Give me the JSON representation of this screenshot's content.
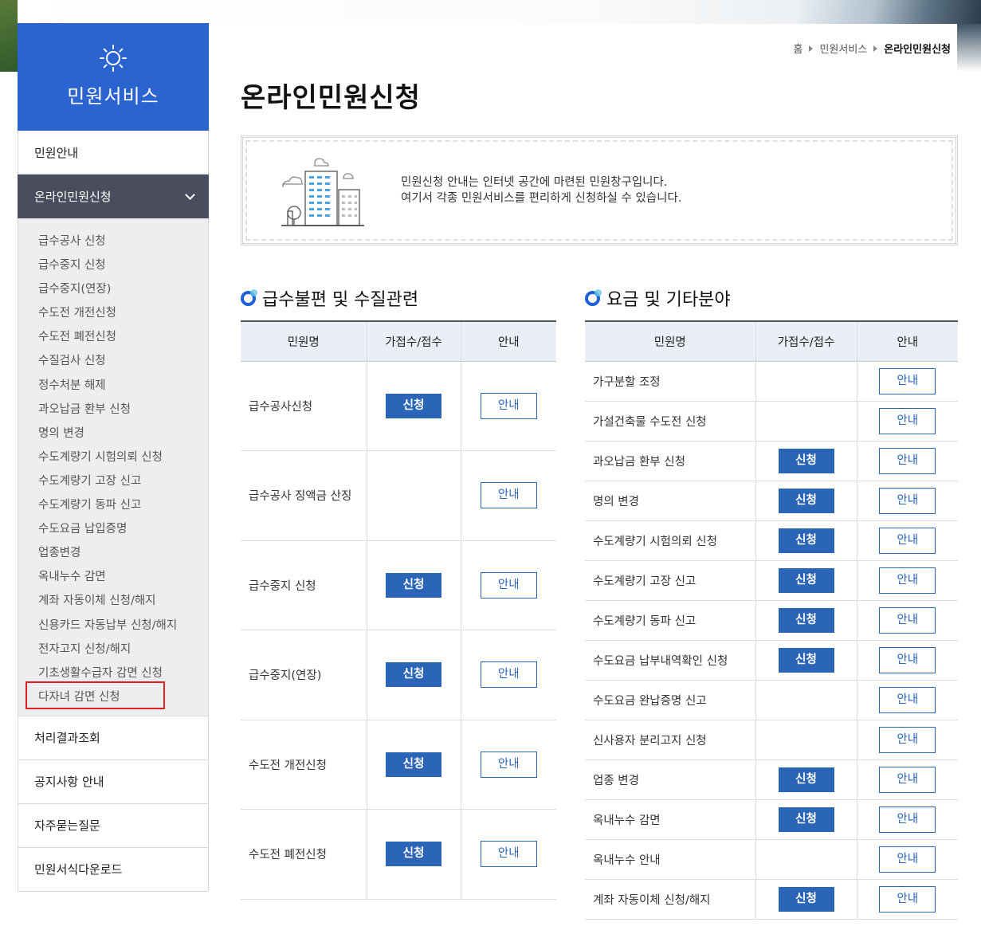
{
  "sidebar": {
    "title": "민원서비스",
    "icon": "sun-icon",
    "items": [
      {
        "label": "민원안내"
      },
      {
        "label": "온라인민원신청"
      },
      {
        "label": "처리결과조회"
      },
      {
        "label": "공지사항 안내"
      },
      {
        "label": "자주묻는질문"
      },
      {
        "label": "민원서식다운로드"
      }
    ],
    "submenu": [
      "급수공사 신청",
      "급수중지 신청",
      "급수중지(연장)",
      "수도전 개전신청",
      "수도전 폐전신청",
      "수질검사 신청",
      "정수처분 해제",
      "과오납금 환부 신청",
      "명의 변경",
      "수도계량기 시험의뢰 신청",
      "수도계량기 고장 신고",
      "수도계량기 동파 신고",
      "수도요금 납입증명",
      "업종변경",
      "옥내누수 감면",
      "계좌 자동이체 신청/해지",
      "신용카드 자동납부 신청/해지",
      "전자고지 신청/해지",
      "기초생활수급자 감면 신청",
      "다자녀 감면 신청"
    ]
  },
  "breadcrumb": {
    "home": "홈",
    "level1": "민원서비스",
    "current": "온라인민원신청"
  },
  "page_title": "온라인민원신청",
  "intro": {
    "line1": "민원신청 안내는 인터넷 공간에 마련된 민원창구입니다.",
    "line2": "여기서 각종 민원서비스를 편리하게 신청하실 수 있습니다."
  },
  "section1": {
    "title": "급수불편 및 수질관련",
    "headers": [
      "민원명",
      "가접수/접수",
      "안내"
    ],
    "rows": [
      {
        "name": "급수공사신청",
        "apply": "신청",
        "guide": "안내"
      },
      {
        "name": "급수공사 징액금 산징",
        "apply": "",
        "guide": "안내"
      },
      {
        "name": "급수중지 신청",
        "apply": "신청",
        "guide": "안내"
      },
      {
        "name": "급수중지(연장)",
        "apply": "신청",
        "guide": "안내"
      },
      {
        "name": "수도전 개전신청",
        "apply": "신청",
        "guide": "안내"
      },
      {
        "name": "수도전 폐전신청",
        "apply": "신청",
        "guide": "안내"
      }
    ]
  },
  "section2": {
    "title": "요금 및 기타분야",
    "headers": [
      "민원명",
      "가접수/접수",
      "안내"
    ],
    "rows": [
      {
        "name": "가구분할 조정",
        "apply": "",
        "guide": "안내"
      },
      {
        "name": "가설건축물 수도전 신청",
        "apply": "",
        "guide": "안내"
      },
      {
        "name": "과오납금 환부 신청",
        "apply": "신청",
        "guide": "안내"
      },
      {
        "name": "명의 변경",
        "apply": "신청",
        "guide": "안내"
      },
      {
        "name": "수도계량기 시험의뢰 신청",
        "apply": "신청",
        "guide": "안내"
      },
      {
        "name": "수도계량기 고장 신고",
        "apply": "신청",
        "guide": "안내"
      },
      {
        "name": "수도계량기 동파 신고",
        "apply": "신청",
        "guide": "안내"
      },
      {
        "name": "수도요금 납부내역확인 신청",
        "apply": "신청",
        "guide": "안내"
      },
      {
        "name": "수도요금 완납증명 신고",
        "apply": "",
        "guide": "안내"
      },
      {
        "name": "신사용자 분리고지 신청",
        "apply": "",
        "guide": "안내"
      },
      {
        "name": "업종 변경",
        "apply": "신청",
        "guide": "안내"
      },
      {
        "name": "옥내누수 감면",
        "apply": "신청",
        "guide": "안내"
      },
      {
        "name": "옥내누수 안내",
        "apply": "",
        "guide": "안내"
      },
      {
        "name": "계좌 자동이체 신청/해지",
        "apply": "신청",
        "guide": "안내"
      }
    ]
  },
  "colors": {
    "brand_blue": "#2b63d0",
    "active_menu": "#4a4d5d",
    "button_blue": "#2b65b8",
    "highlight_red": "#e02020"
  }
}
